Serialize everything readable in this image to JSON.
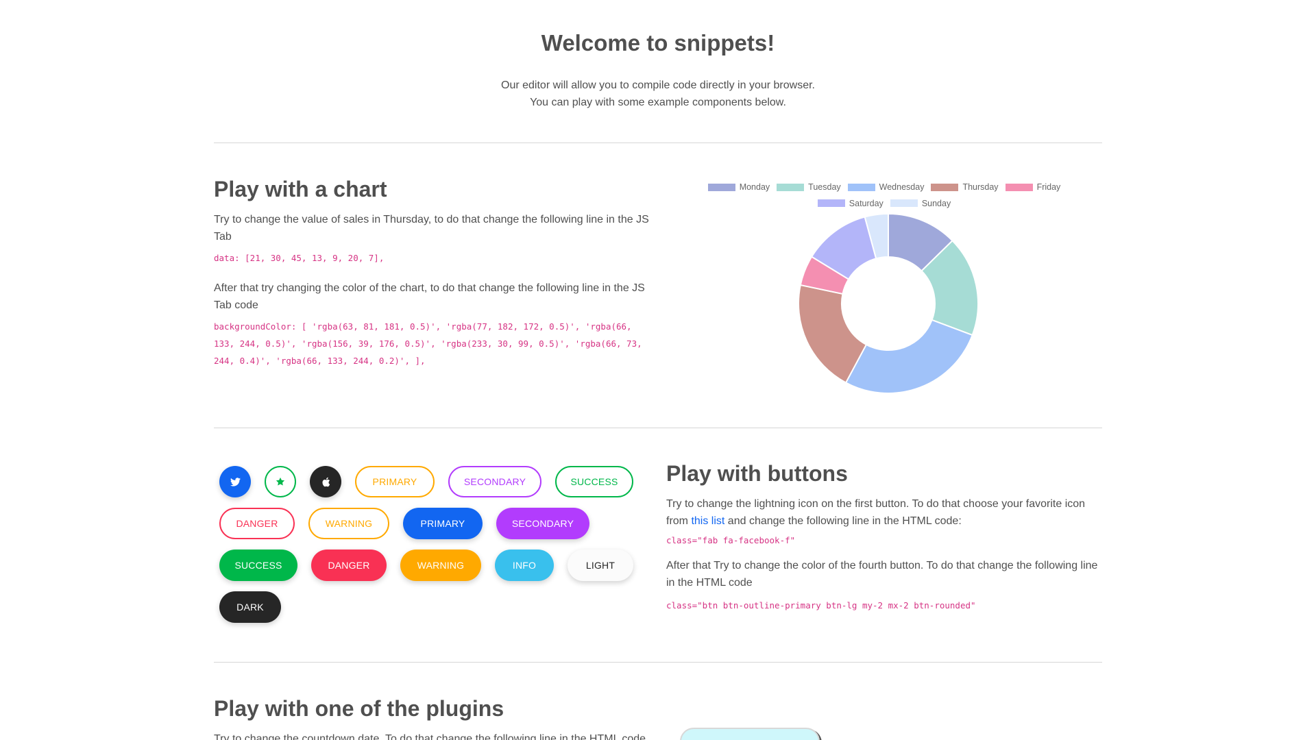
{
  "hero": {
    "title": "Welcome to snippets!",
    "line1": "Our editor will allow you to compile code directly in your browser.",
    "line2": "You can play with some example components below."
  },
  "chart_section": {
    "title": "Play with a chart",
    "text1": "Try to change the value of sales in Thursday, to do that change the following line in the JS Tab",
    "code1": "data: [21, 30, 45, 13, 9, 20, 7],",
    "text2": "After that try changing the color of the chart, to do that change the following line in the JS Tab code",
    "code2": "backgroundColor: [ 'rgba(63, 81, 181, 0.5)', 'rgba(77, 182, 172, 0.5)', 'rgba(66, 133, 244, 0.5)', 'rgba(156, 39, 176, 0.5)', 'rgba(233, 30, 99, 0.5)', 'rgba(66, 73, 244, 0.4)', 'rgba(66, 133, 244, 0.2)', ],"
  },
  "chart_data": {
    "type": "doughnut",
    "categories": [
      "Monday",
      "Tuesday",
      "Wednesday",
      "Thursday",
      "Friday",
      "Saturday",
      "Sunday"
    ],
    "values": [
      21,
      30,
      45,
      34,
      9,
      20,
      7
    ],
    "colors": [
      "#9fa8da",
      "#a6dcd5",
      "#a0c2f9",
      "#cd938b",
      "#f48fb1",
      "#b3b5f9",
      "#d9e7fc"
    ],
    "legend_position": "top"
  },
  "buttons_section": {
    "title": "Play with buttons",
    "text1_a": "Try to change the lightning icon on the first button. To do that choose your favorite icon from ",
    "link": "this list",
    "text1_b": " and change the following line in the HTML code:",
    "code1": "class=\"fab fa-facebook-f\"",
    "text2": "After that Try to change the color of the fourth button. To do that change the following line in the HTML code",
    "code2": "class=\"btn btn-outline-primary btn-lg my-2 mx-2 btn-rounded\""
  },
  "buttons": {
    "primary": "PRIMARY",
    "secondary": "SECONDARY",
    "success": "SUCCESS",
    "danger": "DANGER",
    "warning": "WARNING",
    "info": "INFO",
    "light": "LIGHT",
    "dark": "DARK"
  },
  "colors": {
    "primary": "#1266f1",
    "secondary": "#b23cfd",
    "success": "#00b74a",
    "danger": "#f93154",
    "warning": "#ffa900",
    "info": "#39c0ed",
    "dark": "#262626",
    "code": "#d63384"
  },
  "plugins_section": {
    "title": "Play with one of the plugins",
    "text1": "Try to change the countdown date. To do that change the following line in the HTML code"
  }
}
